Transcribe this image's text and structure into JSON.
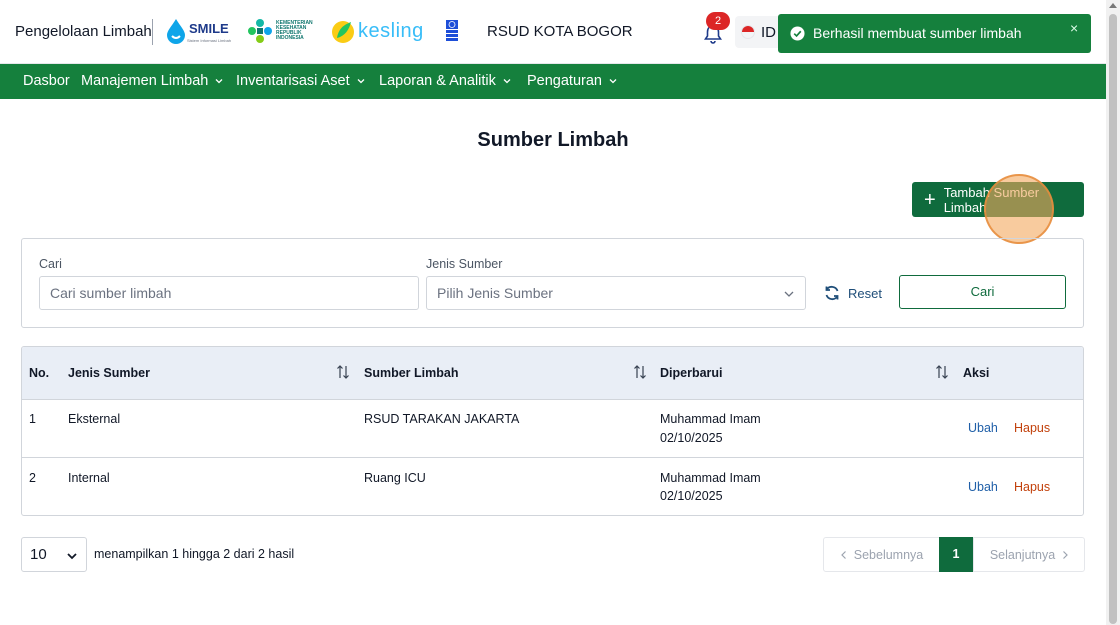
{
  "header": {
    "app_title": "Pengelolaan Limbah",
    "logos": {
      "smile": "SMILE",
      "smile_sub": "Sistem Informasi Limbah",
      "kemenkes": "KEMENTERIAN KESEHATAN REPUBLIK INDONESIA",
      "kesling": "kesling"
    },
    "hospital_name": "RSUD KOTA BOGOR",
    "notification_count": "2",
    "language_code": "ID"
  },
  "toast": {
    "message": "Berhasil membuat sumber limbah",
    "close_glyph": "×",
    "color": "#15803d"
  },
  "nav": {
    "items": [
      {
        "label": "Dasbor"
      },
      {
        "label": "Manajemen Limbah"
      },
      {
        "label": "Inventarisasi Aset"
      },
      {
        "label": "Laporan & Analitik"
      },
      {
        "label": "Pengaturan"
      }
    ],
    "color": "#15803d"
  },
  "page": {
    "title": "Sumber Limbah",
    "add_button_label": "Tambah Sumber Limbah"
  },
  "filters": {
    "search_label": "Cari",
    "search_placeholder": "Cari sumber limbah",
    "type_label": "Jenis Sumber",
    "type_placeholder": "Pilih Jenis Sumber",
    "reset_label": "Reset",
    "search_button_label": "Cari"
  },
  "table": {
    "columns": [
      "No.",
      "Jenis Sumber",
      "Sumber Limbah",
      "Diperbarui",
      "Aksi"
    ],
    "rows": [
      {
        "no": "1",
        "type": "Eksternal",
        "source": "RSUD TARAKAN JAKARTA",
        "updated_by": "Muhammad Imam",
        "updated_date": "02/10/2025",
        "edit": "Ubah",
        "delete": "Hapus"
      },
      {
        "no": "2",
        "type": "Internal",
        "source": "Ruang ICU",
        "updated_by": "Muhammad Imam",
        "updated_date": "02/10/2025",
        "edit": "Ubah",
        "delete": "Hapus"
      }
    ]
  },
  "pagination": {
    "page_size": "10",
    "result_text": "menampilkan 1 hingga 2 dari 2 hasil",
    "prev_label": "Sebelumnya",
    "current_page": "1",
    "next_label": "Selanjutnya"
  }
}
